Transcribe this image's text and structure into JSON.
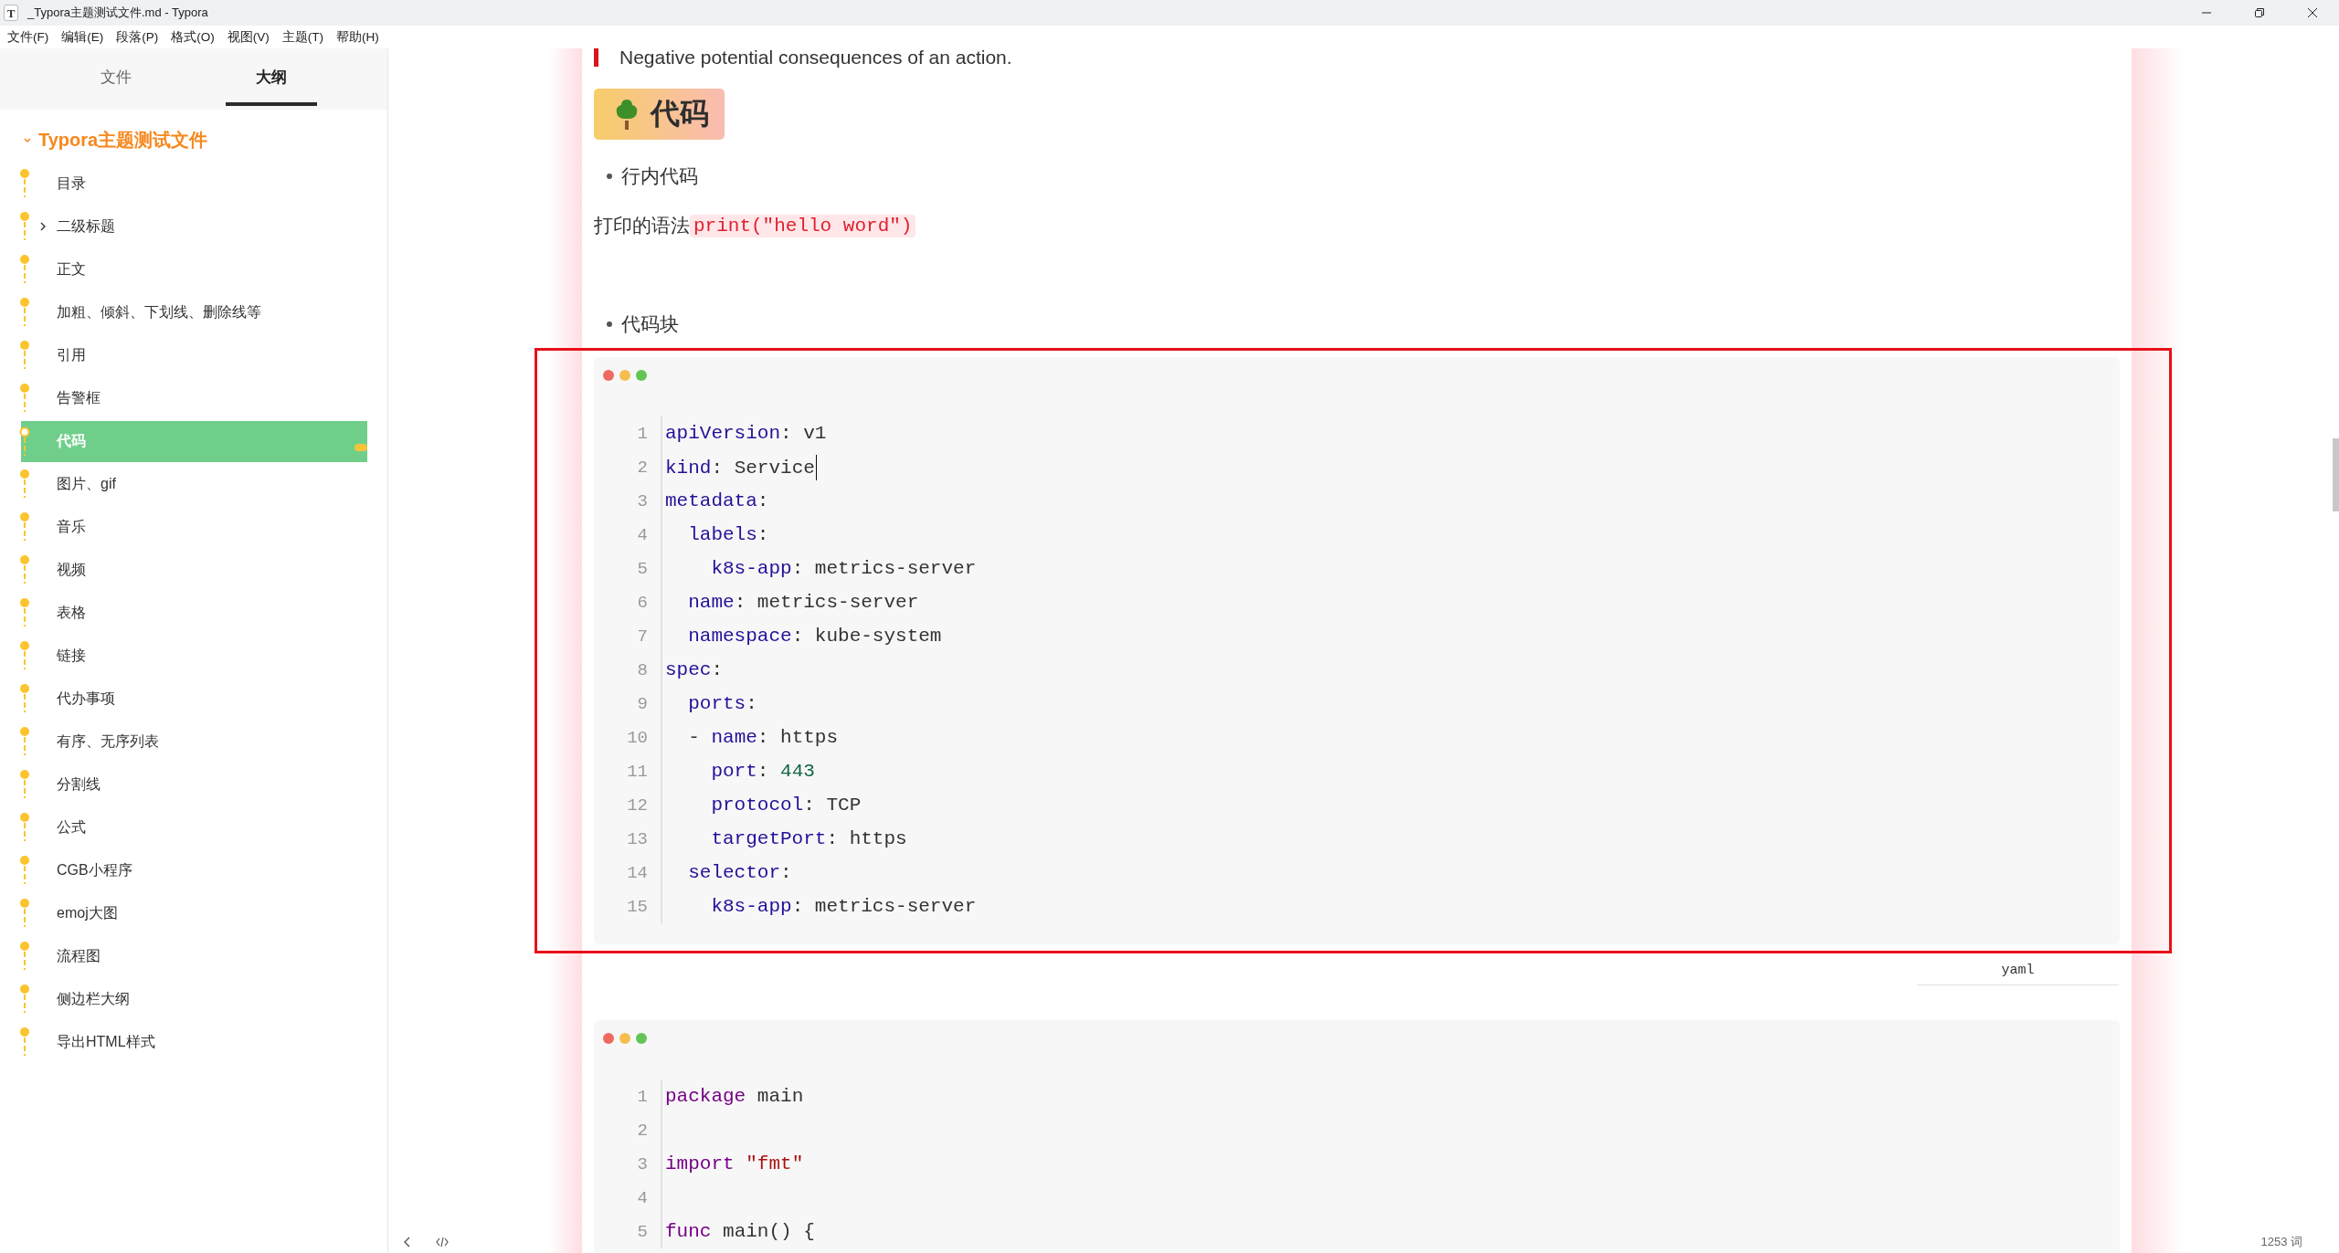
{
  "window": {
    "icon_letter": "T",
    "title": "_Typora主题测试文件.md - Typora"
  },
  "menu": [
    "文件(F)",
    "编辑(E)",
    "段落(P)",
    "格式(O)",
    "视图(V)",
    "主题(T)",
    "帮助(H)"
  ],
  "sidebar": {
    "tabs": [
      {
        "label": "文件",
        "selected": false
      },
      {
        "label": "大纲",
        "selected": true
      }
    ],
    "outline": {
      "label": "Typora主题测试文件",
      "expanded": true,
      "children": [
        {
          "label": "目录",
          "selected": false
        },
        {
          "label": "二级标题",
          "selected": false,
          "expanded": false
        },
        {
          "label": "正文",
          "selected": false
        },
        {
          "label": "加粗、倾斜、下划线、删除线等",
          "selected": false
        },
        {
          "label": "引用",
          "selected": false
        },
        {
          "label": "告警框",
          "selected": false
        },
        {
          "label": "代码",
          "selected": true
        },
        {
          "label": "图片、gif",
          "selected": false
        },
        {
          "label": "音乐",
          "selected": false
        },
        {
          "label": "视频",
          "selected": false
        },
        {
          "label": "表格",
          "selected": false
        },
        {
          "label": "链接",
          "selected": false
        },
        {
          "label": "代办事项",
          "selected": false
        },
        {
          "label": "有序、无序列表",
          "selected": false
        },
        {
          "label": "分割线",
          "selected": false
        },
        {
          "label": "公式",
          "selected": false
        },
        {
          "label": "CGB小程序",
          "selected": false
        },
        {
          "label": "emoj大图",
          "selected": false
        },
        {
          "label": "流程图",
          "selected": false
        },
        {
          "label": "侧边栏大纲",
          "selected": false
        },
        {
          "label": "导出HTML样式",
          "selected": false
        }
      ]
    }
  },
  "document": [
    {
      "kind": "callout",
      "text": "Negative potential consequences of an action."
    },
    {
      "kind": "heading",
      "text": "代码"
    },
    {
      "kind": "bullet",
      "text": "行内代码"
    },
    {
      "kind": "paragraph",
      "text": "打印的语法",
      "code": "print(\"hello word\")"
    },
    {
      "kind": "bullet",
      "text": "代码块"
    },
    {
      "kind": "codeblock",
      "annotated": true,
      "language": "yaml",
      "lines": [
        {
          "number": "1",
          "tokens": [
            {
              "kind": "key",
              "text": "apiVersion"
            },
            {
              "kind": "plain",
              "text": ": v1"
            }
          ]
        },
        {
          "number": "2",
          "caret": true,
          "tokens": [
            {
              "kind": "key",
              "text": "kind"
            },
            {
              "kind": "plain",
              "text": ": Service"
            }
          ]
        },
        {
          "number": "3",
          "tokens": [
            {
              "kind": "key",
              "text": "metadata"
            },
            {
              "kind": "plain",
              "text": ":"
            }
          ]
        },
        {
          "number": "4",
          "tokens": [
            {
              "kind": "key",
              "text": "  labels"
            },
            {
              "kind": "plain",
              "text": ":"
            }
          ]
        },
        {
          "number": "5",
          "tokens": [
            {
              "kind": "key",
              "text": "    k8s-app"
            },
            {
              "kind": "plain",
              "text": ": metrics-server"
            }
          ]
        },
        {
          "number": "6",
          "tokens": [
            {
              "kind": "key",
              "text": "  name"
            },
            {
              "kind": "plain",
              "text": ": metrics-server"
            }
          ]
        },
        {
          "number": "7",
          "tokens": [
            {
              "kind": "key",
              "text": "  namespace"
            },
            {
              "kind": "plain",
              "text": ": kube-system"
            }
          ]
        },
        {
          "number": "8",
          "tokens": [
            {
              "kind": "key",
              "text": "spec"
            },
            {
              "kind": "plain",
              "text": ":"
            }
          ]
        },
        {
          "number": "9",
          "tokens": [
            {
              "kind": "key",
              "text": "  ports"
            },
            {
              "kind": "plain",
              "text": ":"
            }
          ]
        },
        {
          "number": "10",
          "tokens": [
            {
              "kind": "plain",
              "text": "  - "
            },
            {
              "kind": "key",
              "text": "name"
            },
            {
              "kind": "plain",
              "text": ": https"
            }
          ]
        },
        {
          "number": "11",
          "tokens": [
            {
              "kind": "key",
              "text": "    port"
            },
            {
              "kind": "plain",
              "text": ": "
            },
            {
              "kind": "number",
              "text": "443"
            }
          ]
        },
        {
          "number": "12",
          "tokens": [
            {
              "kind": "key",
              "text": "    protocol"
            },
            {
              "kind": "plain",
              "text": ": TCP"
            }
          ]
        },
        {
          "number": "13",
          "tokens": [
            {
              "kind": "key",
              "text": "    targetPort"
            },
            {
              "kind": "plain",
              "text": ": https"
            }
          ]
        },
        {
          "number": "14",
          "tokens": [
            {
              "kind": "key",
              "text": "  selector"
            },
            {
              "kind": "plain",
              "text": ":"
            }
          ]
        },
        {
          "number": "15",
          "tokens": [
            {
              "kind": "key",
              "text": "    k8s-app"
            },
            {
              "kind": "plain",
              "text": ": metrics-server"
            }
          ]
        }
      ]
    },
    {
      "kind": "codeblock",
      "lines": [
        {
          "number": "1",
          "tokens": [
            {
              "kind": "keyword",
              "text": "package"
            },
            {
              "kind": "plain",
              "text": " main"
            }
          ]
        },
        {
          "number": "2"
        },
        {
          "number": "3",
          "tokens": [
            {
              "kind": "keyword",
              "text": "import"
            },
            {
              "kind": "string",
              "text": " \"fmt\""
            }
          ]
        },
        {
          "number": "4"
        },
        {
          "number": "5",
          "tokens": [
            {
              "kind": "keyword",
              "text": "func"
            },
            {
              "kind": "plain",
              "text": " main() {"
            }
          ]
        }
      ]
    }
  ],
  "status_bar": {
    "word_count": "1253 词"
  }
}
